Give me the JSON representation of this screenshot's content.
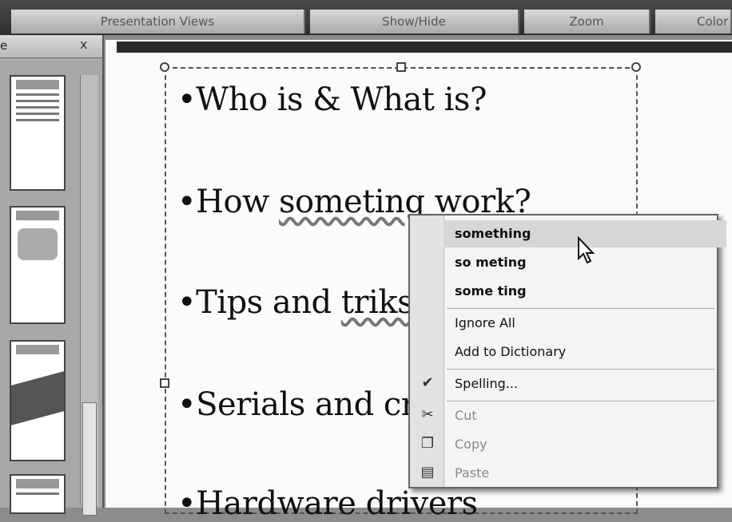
{
  "ribbon": {
    "groups": [
      "Presentation Views",
      "Show/Hide",
      "Zoom",
      "Color"
    ]
  },
  "panel": {
    "tab_label": "e",
    "close_label": "x"
  },
  "slide": {
    "bullets": [
      "•Who is & What is?",
      "•How someting work?",
      "•Tips and triks",
      "•Serials and cra",
      "•Hardware drivers"
    ],
    "misspelled": [
      "someting",
      "triks"
    ]
  },
  "context_menu": {
    "suggestions": [
      "something",
      "so meting",
      "some ting"
    ],
    "ignore_all": "Ignore All",
    "add_to_dictionary": "Add to Dictionary",
    "spelling": "Spelling...",
    "cut": "Cut",
    "copy": "Copy",
    "paste": "Paste",
    "icons": [
      "spelling-check-icon",
      "scissors-icon",
      "copy-icon",
      "paste-icon"
    ]
  }
}
